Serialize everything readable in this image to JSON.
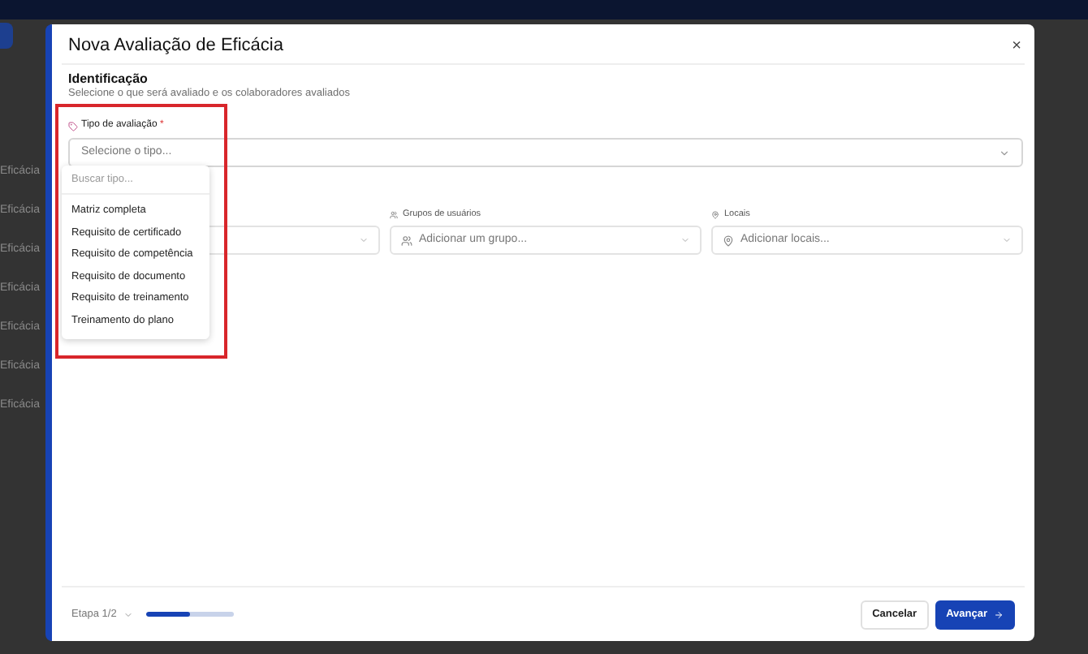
{
  "background_list": [
    "Eficácia",
    "Eficácia",
    "Eficácia",
    "Eficácia",
    "Eficácia",
    "Eficácia",
    "Eficácia"
  ],
  "dialog": {
    "title": "Nova Avaliação de Eficácia",
    "close": "×"
  },
  "section": {
    "title": "Identificação",
    "subtitle": "Selecione o que será avaliado e os colaboradores avaliados"
  },
  "type_field": {
    "label": "Tipo de avaliação",
    "required": "*",
    "placeholder": "Selecione o tipo...",
    "expanded": true,
    "search_placeholder": "Buscar tipo...",
    "options": [
      "Matriz completa",
      "Requisito de certificado",
      "Requisito de competência",
      "Requisito de documento",
      "Requisito de treinamento",
      "Treinamento do plano"
    ]
  },
  "fields": [
    {
      "kind": "hidden"
    },
    {
      "kind": "groups",
      "label": "Grupos de usuários",
      "placeholder": "Adicionar um grupo..."
    },
    {
      "kind": "places",
      "label": "Locais",
      "placeholder": "Adicionar locais..."
    }
  ],
  "footer": {
    "step": "Etapa 1/2",
    "progress": {
      "level": 0.5
    },
    "cancel": "Cancelar",
    "next": "Avançar"
  }
}
